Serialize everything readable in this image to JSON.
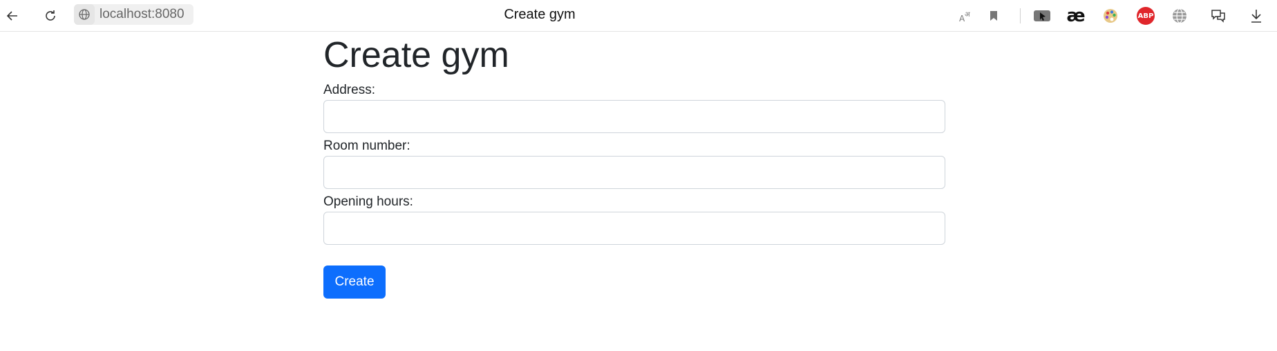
{
  "browser": {
    "url": "localhost:8080",
    "tab_title": "Create gym",
    "icons": {
      "back": "back-arrow-icon",
      "reload": "reload-icon",
      "site": "globe-icon",
      "translate": "translate-icon",
      "bookmark": "bookmark-icon",
      "cursor_ext": "cursor-extension-icon",
      "ae_ext": "ae-extension-icon",
      "palette_ext": "palette-extension-icon",
      "abp_ext": "adblock-plus-icon",
      "globe_ext": "globe-extension-icon",
      "chat_ext": "chat-extension-icon",
      "download": "download-icon"
    },
    "abp_label": "ABP",
    "ae_label": "æ"
  },
  "page": {
    "heading": "Create gym",
    "fields": [
      {
        "label": "Address:",
        "value": "",
        "placeholder": ""
      },
      {
        "label": "Room number:",
        "value": "",
        "placeholder": ""
      },
      {
        "label": "Opening hours:",
        "value": "",
        "placeholder": ""
      }
    ],
    "submit_label": "Create",
    "accent_color": "#0d6efd"
  }
}
